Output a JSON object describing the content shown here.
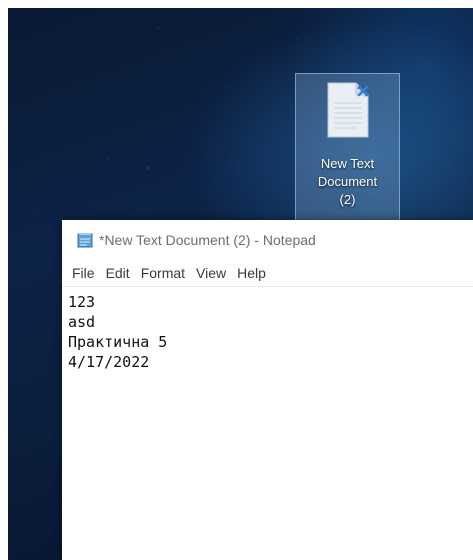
{
  "desktop": {
    "icon": {
      "name": "document-shortcut-icon",
      "label_lines": [
        "New Text",
        "Document",
        "(2)"
      ]
    }
  },
  "notepad": {
    "title": "*New Text Document (2) - Notepad",
    "menu": [
      "File",
      "Edit",
      "Format",
      "View",
      "Help"
    ],
    "content_lines": [
      "123",
      "asd",
      "Практична 5",
      "4/17/2022"
    ]
  }
}
